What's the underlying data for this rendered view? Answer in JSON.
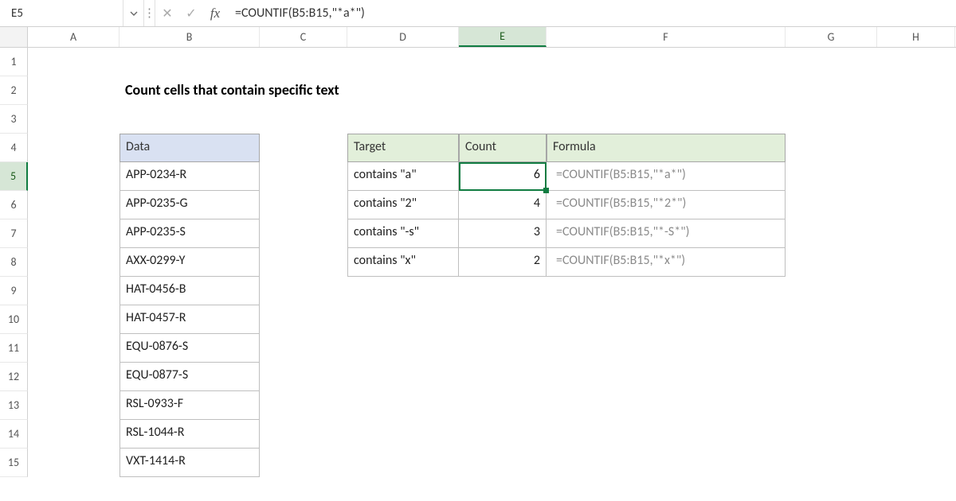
{
  "name_box": "E5",
  "formula_bar": "=COUNTIF(B5:B15,\"*a*\")",
  "columns": [
    "A",
    "B",
    "C",
    "D",
    "E",
    "F",
    "G",
    "H"
  ],
  "active_col": "E",
  "active_row": 5,
  "rows": [
    1,
    2,
    3,
    4,
    5,
    6,
    7,
    8,
    9,
    10,
    11,
    12,
    13,
    14,
    15
  ],
  "title": "Count cells that contain specific text",
  "data_header": "Data",
  "data_values": [
    "APP-0234-R",
    "APP-0235-G",
    "APP-0235-S",
    "AXX-0299-Y",
    "HAT-0456-B",
    "HAT-0457-R",
    "EQU-0876-S",
    "EQU-0877-S",
    "RSL-0933-F",
    "RSL-1044-R",
    "VXT-1414-R"
  ],
  "result_headers": {
    "target": "Target",
    "count": "Count",
    "formula": "Formula"
  },
  "results": [
    {
      "target": "contains \"a\"",
      "count": 6,
      "formula": "=COUNTIF(B5:B15,\"*a*\")"
    },
    {
      "target": "contains \"2\"",
      "count": 4,
      "formula": "=COUNTIF(B5:B15,\"*2*\")"
    },
    {
      "target": "contains \"-s\"",
      "count": 3,
      "formula": "=COUNTIF(B5:B15,\"*-S*\")"
    },
    {
      "target": "contains \"x\"",
      "count": 2,
      "formula": "=COUNTIF(B5:B15,\"*x*\")"
    }
  ],
  "selection": {
    "cell": "E5",
    "value": 6
  }
}
